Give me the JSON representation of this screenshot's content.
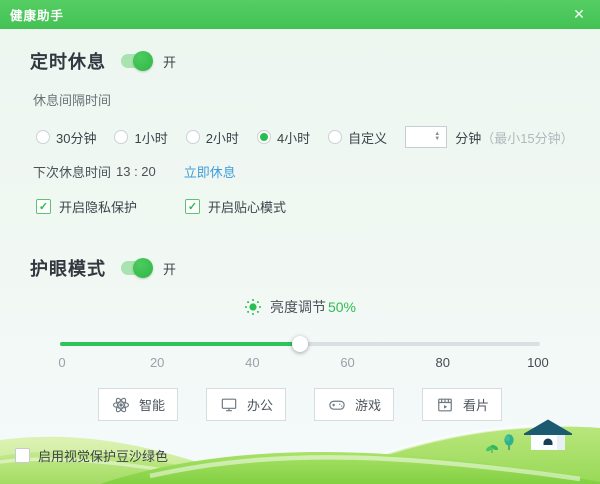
{
  "window": {
    "title": "健康助手",
    "close_glyph": "✕"
  },
  "timed_rest": {
    "heading": "定时休息",
    "state_label": "开",
    "interval_label": "休息间隔时间",
    "options": [
      {
        "label": "30分钟",
        "selected": false
      },
      {
        "label": "1小时",
        "selected": false
      },
      {
        "label": "2小时",
        "selected": false
      },
      {
        "label": "4小时",
        "selected": true
      },
      {
        "label": "自定义",
        "selected": false
      }
    ],
    "custom_input_value": "",
    "custom_unit": "分钟",
    "custom_hint": "（最小15分钟）",
    "next_rest_label": "下次休息时间",
    "next_rest_time": "13 : 20",
    "rest_now_label": "立即休息",
    "checkboxes": [
      {
        "label": "开启隐私保护",
        "checked": true
      },
      {
        "label": "开启贴心模式",
        "checked": true
      }
    ]
  },
  "eye_protection": {
    "heading": "护眼模式",
    "state_label": "开",
    "brightness_label": "亮度调节",
    "brightness_value_text": "50%",
    "slider": {
      "min": 0,
      "max": 100,
      "value": 50,
      "ticks": [
        "0",
        "20",
        "40",
        "60",
        "80",
        "100"
      ]
    },
    "modes": [
      {
        "icon": "atom-icon",
        "label": "智能"
      },
      {
        "icon": "monitor-icon",
        "label": "办公"
      },
      {
        "icon": "gamepad-icon",
        "label": "游戏"
      },
      {
        "icon": "film-icon",
        "label": "看片"
      }
    ]
  },
  "footer": {
    "checkbox_label": "启用视觉保护豆沙绿色",
    "checked": false
  },
  "colors": {
    "header_green": "#47c558",
    "accent_green": "#2ebd52",
    "link_blue": "#3f9ddb"
  }
}
